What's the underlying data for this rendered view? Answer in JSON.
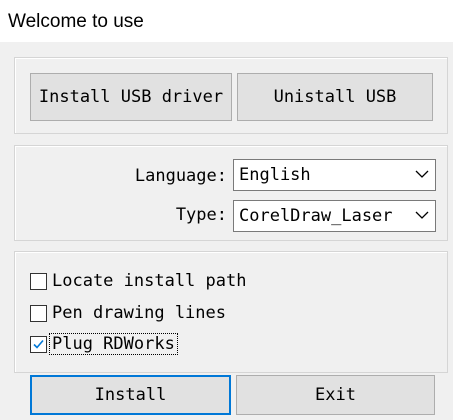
{
  "window": {
    "title": "Welcome to use"
  },
  "driver": {
    "install_usb_label": "Install USB driver",
    "uninstall_usb_label": "Unistall USB"
  },
  "settings": {
    "language_label": "Language:",
    "language_value": "English",
    "type_label": "Type:",
    "type_value": "CorelDraw_Laser"
  },
  "options": {
    "locate_label": "Locate install path",
    "locate_checked": false,
    "pen_label": "Pen drawing lines",
    "pen_checked": false,
    "plug_label": "Plug RDWorks",
    "plug_checked": true
  },
  "actions": {
    "install_label": "Install",
    "exit_label": "Exit"
  },
  "colors": {
    "accent": "#0078d7",
    "dialog_bg": "#f0f0f0",
    "button_bg": "#e1e1e1"
  },
  "icons": {
    "dropdown": "chevron-down-icon",
    "check": "checkmark-icon"
  }
}
